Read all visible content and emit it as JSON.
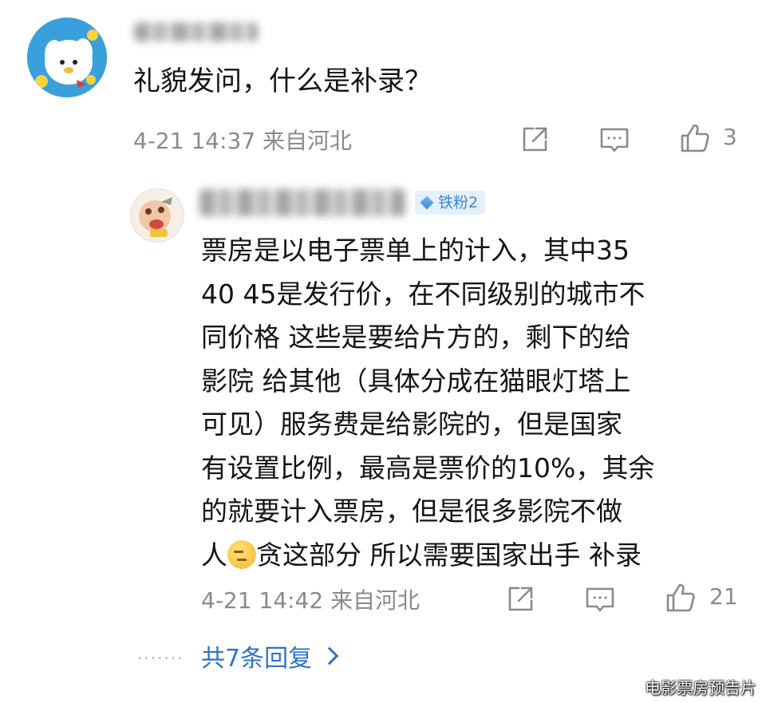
{
  "top_comment": {
    "text": "礼貌发问，什么是补录？",
    "meta": "4-21 14:37 来自河北",
    "like_count": "3",
    "icons": [
      "share-icon",
      "comment-icon",
      "like-icon"
    ]
  },
  "reply": {
    "badge": "铁粉2",
    "lines": [
      "票房是以电子票单上的计入，其中35",
      "40 45是发行价，在不同级别的城市不",
      "同价格 这些是要给片方的，剩下的给",
      "影院 给其他（具体分成在猫眼灯塔上",
      "可见）服务费是给影院的，但是国家",
      "有设置比例，最高是票价的10%，其余",
      "的就要计入票房，但是很多影院不做"
    ],
    "last_line_before_emoji": "人",
    "last_line_after_emoji": "贪这部分 所以需要国家出手 补录",
    "meta": "4-21 14:42 来自河北",
    "like_count": "21"
  },
  "more_replies": {
    "dots": "·······",
    "label": "共7条回复"
  },
  "watermark": "电影票房预告片",
  "colors": {
    "meta_gray": "#8a8a8a",
    "link_blue": "#2f73c6",
    "badge_bg": "#e4f0fc",
    "badge_text": "#3f86d6"
  }
}
